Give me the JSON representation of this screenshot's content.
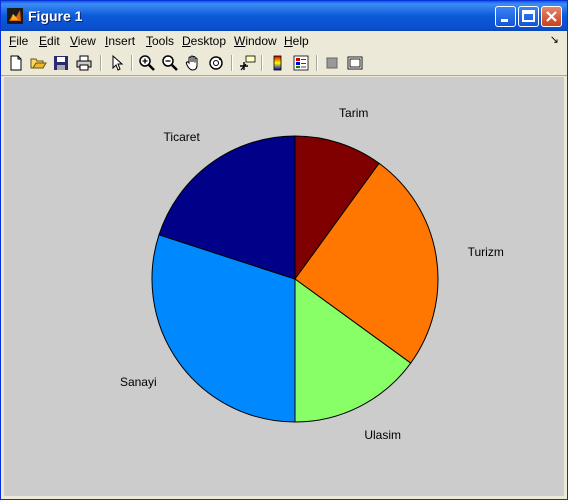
{
  "window": {
    "title": "Figure 1",
    "icon": "matlab-icon"
  },
  "menu": [
    {
      "label": "File",
      "underline": "F",
      "rest": "ile"
    },
    {
      "label": "Edit",
      "underline": "E",
      "rest": "dit"
    },
    {
      "label": "View",
      "underline": "V",
      "rest": "iew"
    },
    {
      "label": "Insert",
      "underline": "I",
      "rest": "nsert"
    },
    {
      "label": "Tools",
      "underline": "T",
      "rest": "ools"
    },
    {
      "label": "Desktop",
      "underline": "D",
      "rest": "esktop"
    },
    {
      "label": "Window",
      "underline": "W",
      "rest": "indow"
    },
    {
      "label": "Help",
      "underline": "H",
      "rest": "elp"
    }
  ],
  "toolbar": [
    "new-figure-icon",
    "open-file-icon",
    "save-icon",
    "print-icon",
    "edit-plot-arrow-icon",
    "zoom-in-icon",
    "zoom-out-icon",
    "pan-hand-icon",
    "rotate-3d-icon",
    "data-cursor-icon",
    "colorbar-icon",
    "legend-icon",
    "hide-plot-tools-icon",
    "show-plot-tools-icon"
  ],
  "chart_data": {
    "type": "pie",
    "categories": [
      "Tarim",
      "Turizm",
      "Ulasim",
      "Sanayi",
      "Ticaret"
    ],
    "values": [
      10,
      25,
      15,
      30,
      20
    ],
    "colors": [
      "#800000",
      "#ff7700",
      "#88ff66",
      "#0088ff",
      "#000088"
    ],
    "start": "top",
    "direction": "clockwise",
    "legend": "none"
  }
}
